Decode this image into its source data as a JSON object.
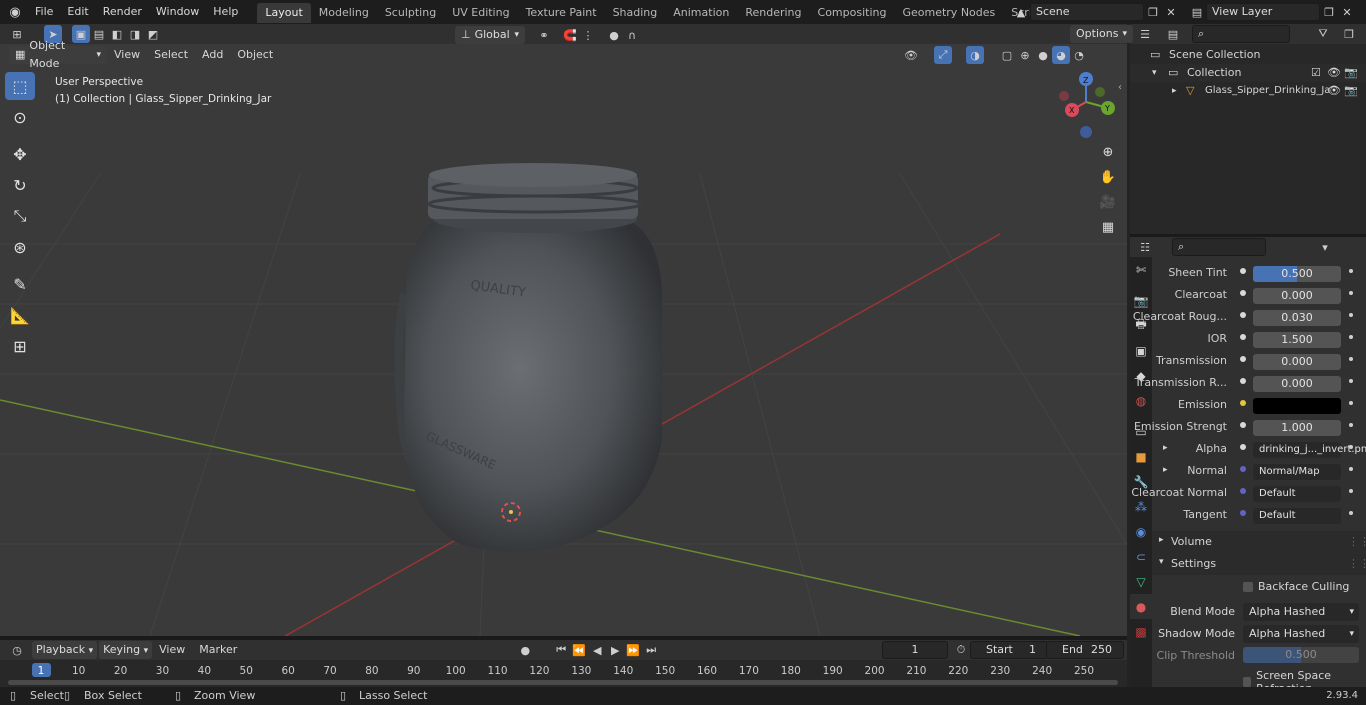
{
  "menu": [
    "File",
    "Edit",
    "Render",
    "Window",
    "Help"
  ],
  "workspaces": [
    "Layout",
    "Modeling",
    "Sculpting",
    "UV Editing",
    "Texture Paint",
    "Shading",
    "Animation",
    "Rendering",
    "Compositing",
    "Geometry Nodes",
    "Scripting"
  ],
  "active_workspace": "Layout",
  "scene_name": "Scene",
  "view_layer": "View Layer",
  "viewport": {
    "mode": "Object Mode",
    "menus": [
      "View",
      "Select",
      "Add",
      "Object"
    ],
    "orientation": "Global",
    "options_label": "Options",
    "info_line1": "User Perspective",
    "info_line2": "(1) Collection | Glass_Sipper_Drinking_Jar",
    "jar_text_top": "QUALITY",
    "jar_text_bottom": "GLASSWARE",
    "gizmo": {
      "x": "X",
      "y": "Y",
      "z": "Z"
    }
  },
  "outliner": {
    "scene_collection": "Scene Collection",
    "collection": "Collection",
    "object": "Glass_Sipper_Drinking_Ja"
  },
  "properties": {
    "rows": [
      {
        "label": "Sheen Tint",
        "value": "0.500",
        "dot": "#d8d8d8",
        "fill": 0.5
      },
      {
        "label": "Clearcoat",
        "value": "0.000",
        "dot": "#d8d8d8"
      },
      {
        "label": "Clearcoat Roug...",
        "value": "0.030",
        "dot": "#d8d8d8"
      },
      {
        "label": "IOR",
        "value": "1.500",
        "dot": "#d8d8d8"
      },
      {
        "label": "Transmission",
        "value": "0.000",
        "dot": "#d8d8d8"
      },
      {
        "label": "Transmission R...",
        "value": "0.000",
        "dot": "#d8d8d8"
      },
      {
        "label": "Emission",
        "value": "",
        "dot": "#e2c73a",
        "color": "#000000"
      },
      {
        "label": "Emission Strengt",
        "value": "1.000",
        "dot": "#d8d8d8"
      },
      {
        "label": "Alpha",
        "value": "drinking_j..._invert.pn",
        "dot": "#d8d8d8",
        "expand": true,
        "link": true
      },
      {
        "label": "Normal",
        "value": "Normal/Map",
        "dot": "#6363c7",
        "expand": true,
        "link": true
      },
      {
        "label": "Clearcoat Normal",
        "value": "Default",
        "dot": "#6363c7",
        "link": true
      },
      {
        "label": "Tangent",
        "value": "Default",
        "dot": "#6363c7",
        "link": true
      }
    ],
    "volume_label": "Volume",
    "settings_label": "Settings",
    "backface_culling": "Backface Culling",
    "blend_mode_label": "Blend Mode",
    "blend_mode": "Alpha Hashed",
    "shadow_mode_label": "Shadow Mode",
    "shadow_mode": "Alpha Hashed",
    "clip_threshold_label": "Clip Threshold",
    "clip_threshold": "0.500",
    "screen_space_refraction": "Screen Space Refraction"
  },
  "timeline": {
    "menus": [
      "Playback",
      "Keying",
      "View",
      "Marker"
    ],
    "current_frame": "1",
    "start_label": "Start",
    "start": "1",
    "end_label": "End",
    "end": "250",
    "ticks": [
      "1",
      "10",
      "20",
      "30",
      "40",
      "50",
      "60",
      "70",
      "80",
      "90",
      "100",
      "110",
      "120",
      "130",
      "140",
      "150",
      "160",
      "170",
      "180",
      "190",
      "200",
      "210",
      "220",
      "230",
      "240",
      "250"
    ]
  },
  "statusbar": {
    "select": "Select",
    "box_select": "Box Select",
    "zoom_view": "Zoom View",
    "lasso_select": "Lasso Select",
    "version": "2.93.4"
  }
}
